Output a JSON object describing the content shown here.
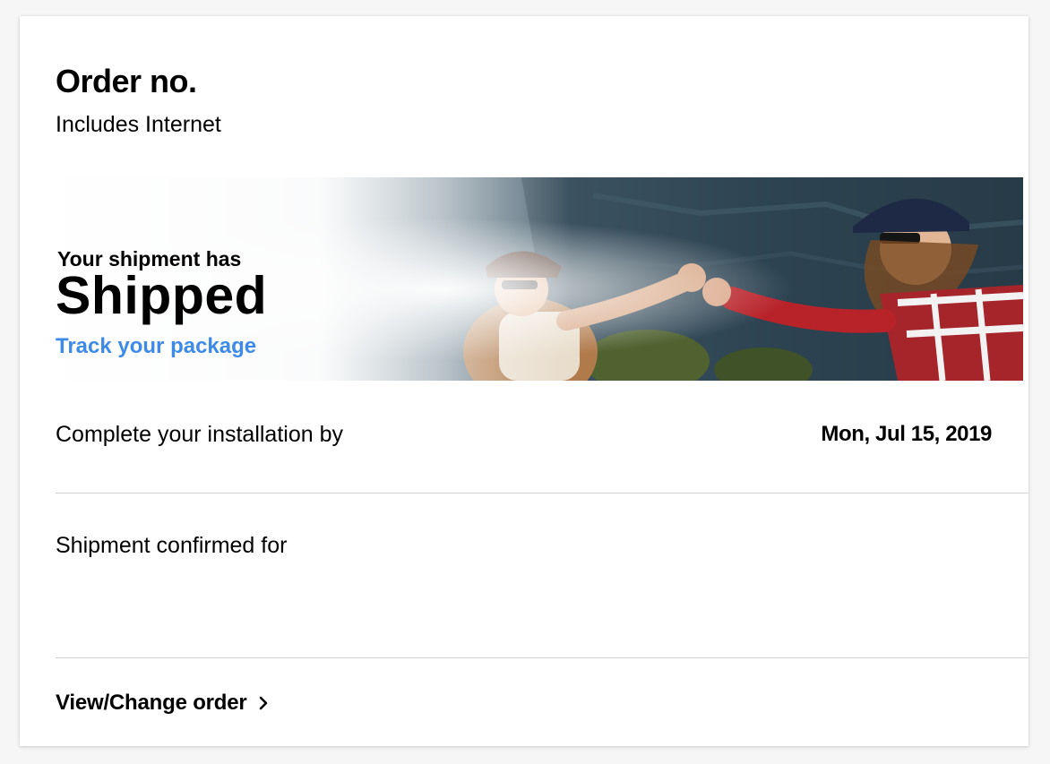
{
  "order": {
    "title": "Order no.",
    "includes": "Includes Internet"
  },
  "shipment": {
    "lead": "Your shipment has",
    "status": "Shipped",
    "track_link": "Track your package",
    "image": "photo-two-friends-fist-bump-mountains"
  },
  "installation": {
    "label": "Complete your installation by",
    "date": "Mon, Jul 15, 2019"
  },
  "confirmation": {
    "label": "Shipment confirmed for"
  },
  "actions": {
    "view_change_order": "View/Change order",
    "chevron_icon": "chevron-right-icon"
  },
  "colors": {
    "link": "#3d8ae8",
    "text": "#000000",
    "divider": "#cfcfcf",
    "background": "#f6f6f6",
    "card": "#ffffff"
  }
}
